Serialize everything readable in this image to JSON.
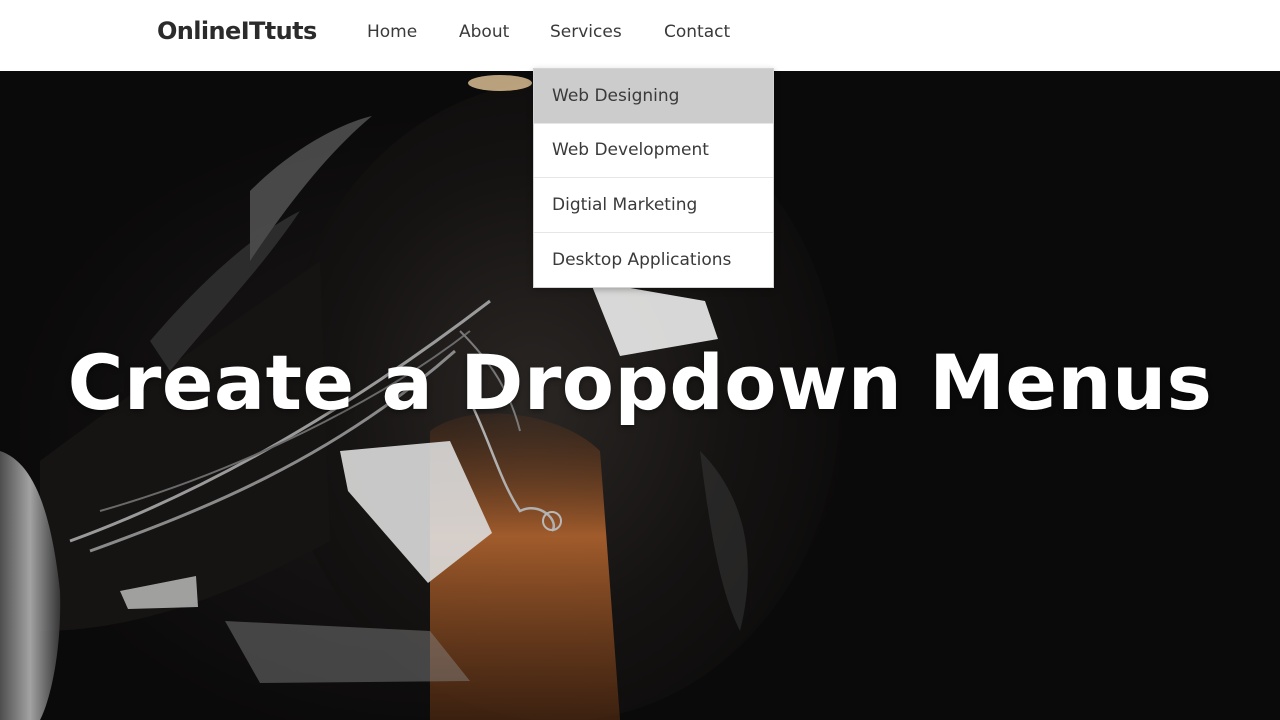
{
  "header": {
    "brand": "OnlineITtuts",
    "nav": {
      "home": "Home",
      "about": "About",
      "services": "Services",
      "contact": "Contact"
    }
  },
  "dropdown": {
    "items": [
      {
        "label": "Web Designing",
        "active": true
      },
      {
        "label": "Web Development",
        "active": false
      },
      {
        "label": "Digtial Marketing",
        "active": false
      },
      {
        "label": "Desktop Applications",
        "active": false
      }
    ]
  },
  "hero": {
    "headline": "Create a Dropdown Menus"
  },
  "colors": {
    "header_bg": "#ffffff",
    "dropdown_active_bg": "#cccccc",
    "hero_bg": "#0b0a0a",
    "headline": "#ffffff",
    "bulb_glow": "#c9783a"
  },
  "icons": {
    "hero_image": "light-bulb-photo"
  }
}
